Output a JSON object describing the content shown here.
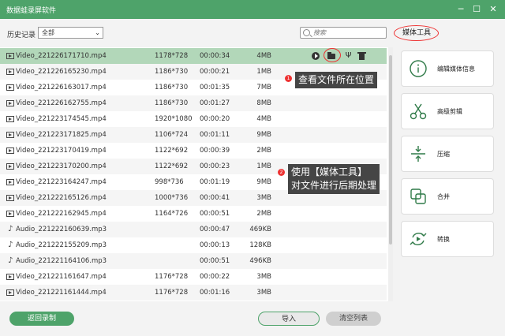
{
  "window": {
    "title": "数据蛙录屏软件",
    "controls": [
      "─",
      "☐",
      "✕"
    ]
  },
  "toolbar": {
    "history_label": "历史记录",
    "filter_value": "全部",
    "search_placeholder": "搜索",
    "media_tools_tab": "媒体工具"
  },
  "files": [
    {
      "type": "video",
      "name": "Video_221226171710.mp4",
      "resolution": "1178*728",
      "duration": "00:00:34",
      "size": "4MB",
      "selected": true
    },
    {
      "type": "video",
      "name": "Video_221226165230.mp4",
      "resolution": "1186*730",
      "duration": "00:00:21",
      "size": "1MB"
    },
    {
      "type": "video",
      "name": "Video_221226163017.mp4",
      "resolution": "1186*730",
      "duration": "00:01:35",
      "size": "7MB"
    },
    {
      "type": "video",
      "name": "Video_221226162755.mp4",
      "resolution": "1186*730",
      "duration": "00:01:27",
      "size": "8MB"
    },
    {
      "type": "video",
      "name": "Video_221223174545.mp4",
      "resolution": "1920*1080",
      "duration": "00:00:20",
      "size": "4MB"
    },
    {
      "type": "video",
      "name": "Video_221223171825.mp4",
      "resolution": "1106*724",
      "duration": "00:01:11",
      "size": "9MB"
    },
    {
      "type": "video",
      "name": "Video_221223170419.mp4",
      "resolution": "1122*692",
      "duration": "00:00:39",
      "size": "2MB"
    },
    {
      "type": "video",
      "name": "Video_221223170200.mp4",
      "resolution": "1122*692",
      "duration": "00:00:23",
      "size": "1MB"
    },
    {
      "type": "video",
      "name": "Video_221223164247.mp4",
      "resolution": "998*736",
      "duration": "00:01:19",
      "size": "9MB"
    },
    {
      "type": "video",
      "name": "Video_221222165126.mp4",
      "resolution": "1000*736",
      "duration": "00:00:41",
      "size": "3MB"
    },
    {
      "type": "video",
      "name": "Video_221222162945.mp4",
      "resolution": "1164*726",
      "duration": "00:00:51",
      "size": "2MB"
    },
    {
      "type": "audio",
      "name": "Audio_221222160639.mp3",
      "resolution": "",
      "duration": "00:00:47",
      "size": "469KB"
    },
    {
      "type": "audio",
      "name": "Audio_221222155209.mp3",
      "resolution": "",
      "duration": "00:00:13",
      "size": "128KB"
    },
    {
      "type": "audio",
      "name": "Audio_221221164106.mp3",
      "resolution": "",
      "duration": "00:00:51",
      "size": "496KB"
    },
    {
      "type": "video",
      "name": "Video_221221161647.mp4",
      "resolution": "1176*728",
      "duration": "00:00:22",
      "size": "3MB"
    },
    {
      "type": "video",
      "name": "Video_221221161444.mp4",
      "resolution": "1176*728",
      "duration": "00:01:16",
      "size": "3MB"
    }
  ],
  "row_actions": {
    "play_icon": "play-icon",
    "folder_icon": "folder-icon",
    "edit_icon": "edit-icon",
    "delete_icon": "trash-icon"
  },
  "media_tools": [
    {
      "id": "info",
      "label": "编辑媒体信息",
      "icon": "info-icon"
    },
    {
      "id": "cut",
      "label": "高级剪辑",
      "icon": "scissors-icon"
    },
    {
      "id": "compress",
      "label": "压缩",
      "icon": "compress-icon"
    },
    {
      "id": "merge",
      "label": "合并",
      "icon": "merge-icon"
    },
    {
      "id": "convert",
      "label": "转换",
      "icon": "convert-icon"
    }
  ],
  "annotations": [
    {
      "badge": "1",
      "text": "查看文件所在位置"
    },
    {
      "badge": "2",
      "text_line1": "使用【媒体工具】",
      "text_line2": "对文件进行后期处理"
    }
  ],
  "footer": {
    "back_label": "返回录制",
    "import_label": "导入",
    "clear_label": "清空列表"
  },
  "colors": {
    "brand_green": "#4ea36a",
    "selected_row": "#b2d7b9",
    "annotation_red": "#e33333",
    "callout_bg": "#454545"
  }
}
